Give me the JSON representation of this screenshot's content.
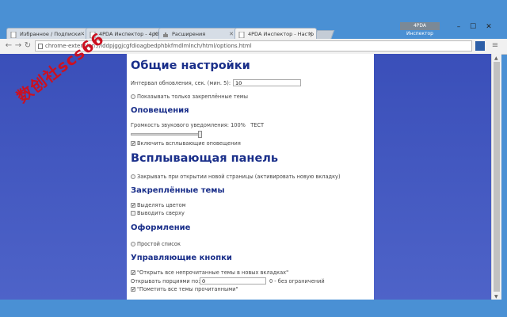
{
  "browser": {
    "tabs": [
      {
        "label": "Избранное / Подписки -"
      },
      {
        "label": "4PDA Инспектор - 4pda"
      },
      {
        "label": "Расширения"
      },
      {
        "label": "4PDA Инспектор - Настр"
      }
    ],
    "profile_label": "4PDA Инспектор",
    "url": "chrome-extension://lddpjggjcgfdioagbedphbkfmdlmlnch/html/options.html"
  },
  "watermark": "数创社scs66",
  "settings": {
    "general_title": "Общие настройки",
    "interval_label": "Интервал обновления, сек. (мин. 5):",
    "interval_value": "10",
    "only_pinned_label": "Показывать только закреплённые темы",
    "notifications_title": "Оповещения",
    "volume_label": "Громкость звукового уведомления: 100%",
    "test_label": "ТЕСТ",
    "popup_notif_label": "Включить всплывающие оповещения",
    "popup_panel_title": "Всплывающая панель",
    "close_on_open_label": "Закрывать при открытии новой страницы (активировать новую вкладку)",
    "pinned_title": "Закреплённые темы",
    "highlight_label": "Выделять цветом",
    "show_top_label": "Выводить сверху",
    "design_title": "Оформление",
    "simple_list_label": "Простой список",
    "buttons_title": "Управляющие кнопки",
    "open_all_label": "\"Открыть все непрочитанные темы в новых вкладках\"",
    "open_portions_label": "Открывать порциями по:",
    "open_portions_value": "0",
    "open_portions_hint": "0 - без ограничений",
    "mark_all_label": "\"Пометить все темы прочитанными\""
  }
}
